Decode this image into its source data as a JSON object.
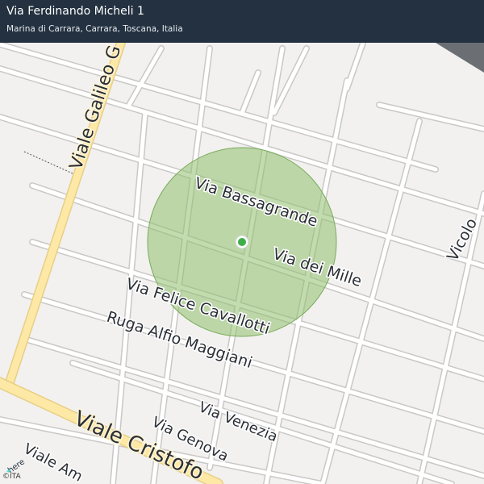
{
  "header": {
    "title": "Via Ferdinando Micheli 1",
    "subtitle": "Marina di Carrara, Carrara, Toscana, Italia"
  },
  "map": {
    "streets": {
      "viale_galileo": "Viale Galileo G",
      "via_bassagrande": "Via  Bassagrande",
      "via_dei_mille": "Via  dei  Mille",
      "via_felice_cavallotti": "Via  Felice  Cavallotti",
      "ruga_alfio_maggiani": "Ruga  Alfio  Maggiani",
      "via_venezia": "Via  Venezia",
      "via_genova": "Via  Genova",
      "viale_cristoforo": "Viale  Cristofo",
      "viale_am": "Viale  Am",
      "vicolo": "Vicolo"
    },
    "accuracy_circle_color": "#8fbf6e",
    "marker_color": "#3fae49",
    "main_road_color": "#fde8a6"
  },
  "footer": {
    "logo_text": "here",
    "copyright": "©ITA"
  }
}
